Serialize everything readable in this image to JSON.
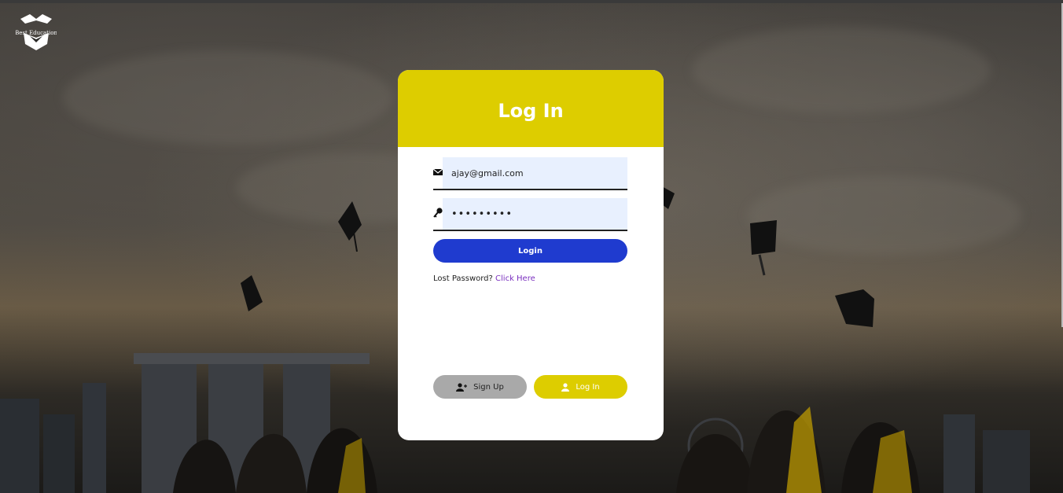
{
  "brand": {
    "logo_text": "Best Education"
  },
  "card": {
    "title": "Log In",
    "email": {
      "value": "ajay@gmail.com",
      "icon": "envelope-icon"
    },
    "password": {
      "value": "•••••••••",
      "icon": "key-icon"
    },
    "login_button": "Login",
    "lost_password": {
      "prefix": "Lost Password?",
      "link": "Click Here"
    },
    "tabs": {
      "signup": {
        "label": "Sign Up",
        "icon": "user-plus-icon"
      },
      "login": {
        "label": "Log In",
        "icon": "user-icon"
      }
    }
  },
  "colors": {
    "header_yellow": "#ddcd00",
    "login_blue": "#1f3bcf",
    "link_purple": "#7a2fbf",
    "signup_gray": "#a9a9a9"
  }
}
